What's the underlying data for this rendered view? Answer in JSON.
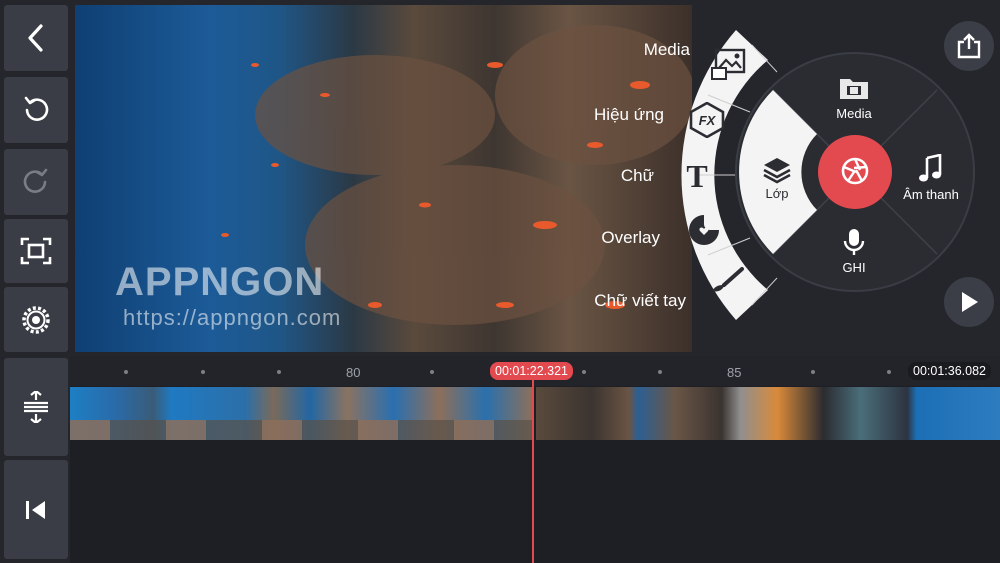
{
  "preview": {
    "watermark_logo": "APPNGON",
    "watermark_url": "https://appngon.com"
  },
  "arc_menu": {
    "items": [
      {
        "label": "Media",
        "icon": "media-photo-icon"
      },
      {
        "label": "Hiệu ứng",
        "icon": "fx-icon"
      },
      {
        "label": "Chữ",
        "icon": "text-T-icon"
      },
      {
        "label": "Overlay",
        "icon": "sticker-icon"
      },
      {
        "label": "Chữ viết tay",
        "icon": "brush-icon"
      }
    ]
  },
  "wheel": {
    "top_label": "Media",
    "right_label": "Âm thanh",
    "bottom_label": "GHI",
    "left_label": "Lớp",
    "accent_color": "#e24a4f"
  },
  "timeline": {
    "playhead_time": "00:01:22.321",
    "end_time": "00:01:36.082",
    "ruler_numbers": [
      "80",
      "85"
    ],
    "playhead_color": "#e24a4f"
  },
  "colors": {
    "background": "#24262c",
    "button_bg": "#3a3d45",
    "accent": "#e24a4f"
  }
}
